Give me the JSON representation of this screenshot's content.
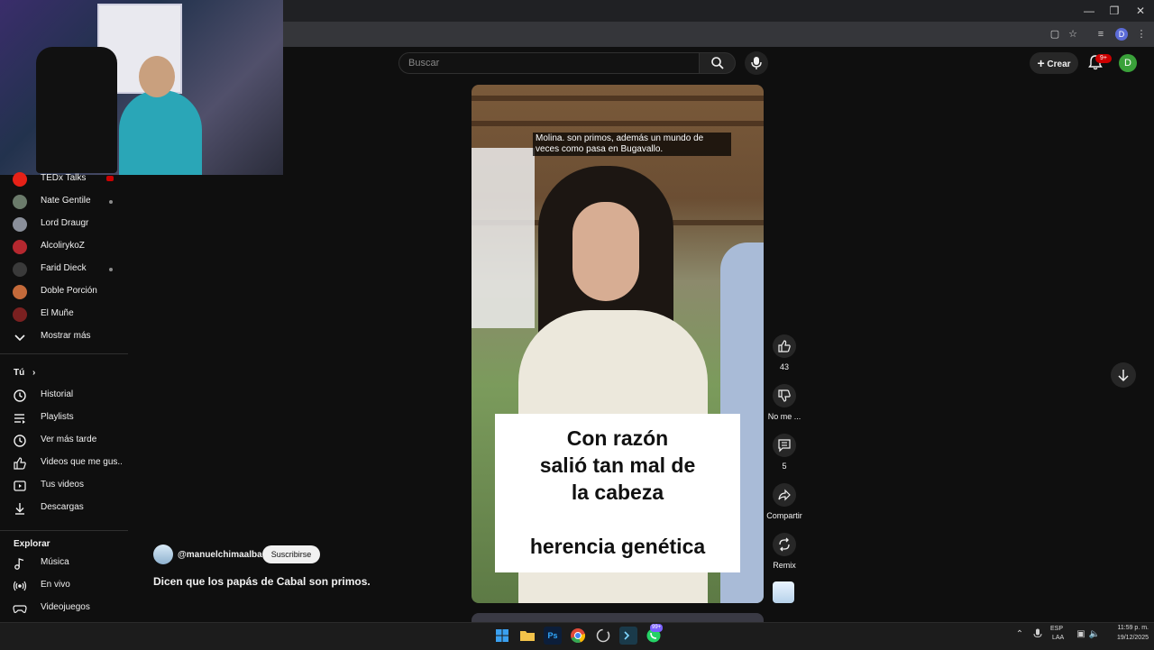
{
  "youtube": {
    "search": {
      "placeholder": "Buscar"
    },
    "header": {
      "create_label": "Crear",
      "notifications_badge": "9+",
      "avatar_letter": "D"
    },
    "sidebar": {
      "subscriptions": [
        {
          "label": "TEDx Talks",
          "color": "#e62117"
        },
        {
          "label": "Nate Gentile",
          "color": "#6b7b6b"
        },
        {
          "label": "Lord Draugr",
          "color": "#8a8f9a"
        },
        {
          "label": "AlcolirykoZ",
          "color": "#b5282f"
        },
        {
          "label": "Farid Dieck",
          "color": "#3a3a3a"
        },
        {
          "label": "Doble Porción",
          "color": "#c46a3a"
        },
        {
          "label": "El Muñe",
          "color": "#7a2020"
        }
      ],
      "show_more": "Mostrar más",
      "you_heading": "Tú",
      "you_items": [
        "Historial",
        "Playlists",
        "Ver más tarde",
        "Videos que me gus...",
        "Tus videos",
        "Descargas"
      ],
      "explore_heading": "Explorar",
      "explore_items": [
        "Música",
        "En vivo",
        "Videojuegos"
      ]
    },
    "short": {
      "caption": "Molina. son primos, además un mundo de veces como pasa en Bugavallo.",
      "card_lines": [
        "Con razón",
        "salió tan mal de",
        "la cabeza",
        "herencia genética"
      ],
      "actions": {
        "like_count": "43",
        "dislike_label": "No me ...",
        "comments_count": "5",
        "share_label": "Compartir",
        "remix_label": "Remix"
      },
      "channel_handle": "@manuelchimaalba",
      "subscribe_label": "Suscribirse",
      "title": "Dicen que los papás de Cabal son primos."
    }
  },
  "taskbar": {
    "chat_badge": "99+",
    "lang": [
      "ESP",
      "LAA"
    ],
    "time": "11:59 p. m.",
    "date": "19/12/2025"
  },
  "colors": {
    "background": "#0f0f0f",
    "accent_red": "#cc0000",
    "avatar_green": "#3aa13a"
  }
}
